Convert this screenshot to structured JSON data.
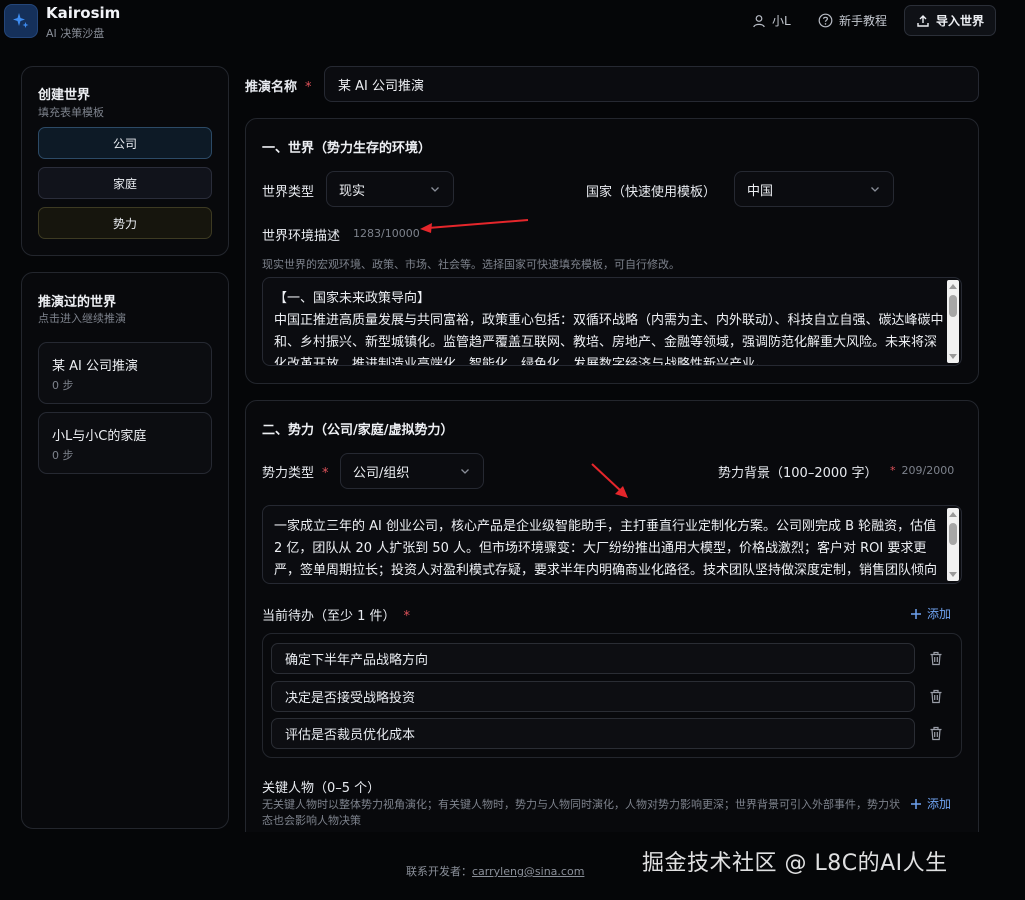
{
  "app": {
    "title": "Kairosim",
    "subtitle": "AI 决策沙盘"
  },
  "topbar": {
    "user": "小L",
    "tutorial": "新手教程",
    "import_label": "导入世界"
  },
  "sidebar": {
    "create": {
      "title": "创建世界",
      "subtitle": "填充表单模板",
      "templates": [
        "公司",
        "家庭",
        "势力"
      ]
    },
    "history": {
      "title": "推演过的世界",
      "subtitle": "点击进入继续推演",
      "items": [
        {
          "name": "某 AI 公司推演",
          "steps": "0 步"
        },
        {
          "name": "小L与小C的家庭",
          "steps": "0 步"
        }
      ]
    }
  },
  "form": {
    "name_label": "推演名称",
    "required_mark": "*",
    "name_value": "某 AI 公司推演"
  },
  "world": {
    "section_title": "一、世界（势力生存的环境）",
    "type_label": "世界类型",
    "type_value": "现实",
    "country_label": "国家（快速使用模板）",
    "country_value": "中国",
    "desc_label": "世界环境描述",
    "desc_counter": "1283/10000",
    "desc_hint": "现实世界的宏观环境、政策、市场、社会等。选择国家可快速填充模板，可自行修改。",
    "desc_text": "【一、国家未来政策导向】\n中国正推进高质量发展与共同富裕，政策重心包括：双循环战略（内需为主、内外联动）、科技自立自强、碳达峰碳中和、乡村振兴、新型城镇化。监管趋严覆盖互联网、教培、房地产、金融等领域，强调防范化解重大风险。未来将深化改革开放，推进制造业高端化、智能化、绿色化，发展数字经济与战略性新兴产业。"
  },
  "power": {
    "section_title": "二、势力（公司/家庭/虚拟势力）",
    "type_label": "势力类型",
    "type_value": "公司/组织",
    "bg_label": "势力背景（100–2000 字）",
    "bg_counter": "209/2000",
    "bg_text": "一家成立三年的 AI 创业公司，核心产品是企业级智能助手，主打垂直行业定制化方案。公司刚完成 B 轮融资，估值 2 亿，团队从 20 人扩张到 50 人。但市场环境骤变：大厂纷纷推出通用大模型，价格战激烈；客户对 ROI 要求更严，签单周期拉长；投资人对盈利模式存疑，要求半年内明确商业化路径。技术团队坚持做深度定制，销售团队倾向接标准化项目冲业绩，两者存在张力。CEO 需在战略聚焦、成本控制与团队扩张之间做出取舍。",
    "todo_label": "当前待办（至少 1 件）",
    "add_label": "添加",
    "todos": [
      "确定下半年产品战略方向",
      "决定是否接受战略投资",
      "评估是否裁员优化成本"
    ],
    "people_label": "关键人物（0–5 个）",
    "people_hint": "无关键人物时以整体势力视角演化；有关键人物时，势力与人物同时演化，人物对势力影响更深；世界背景可引入外部事件，势力状态也会影响人物决策",
    "people_add_label": "添加"
  },
  "footer": {
    "contact_label": "联系开发者：",
    "email": "carryleng@sina.com"
  },
  "watermark": "掘金技术社区 @ L8C的AI人生",
  "colors": {
    "accent": "#6fa3f0",
    "required": "#e0525a",
    "annotation_arrow": "#e5262b",
    "background": "#050608"
  }
}
